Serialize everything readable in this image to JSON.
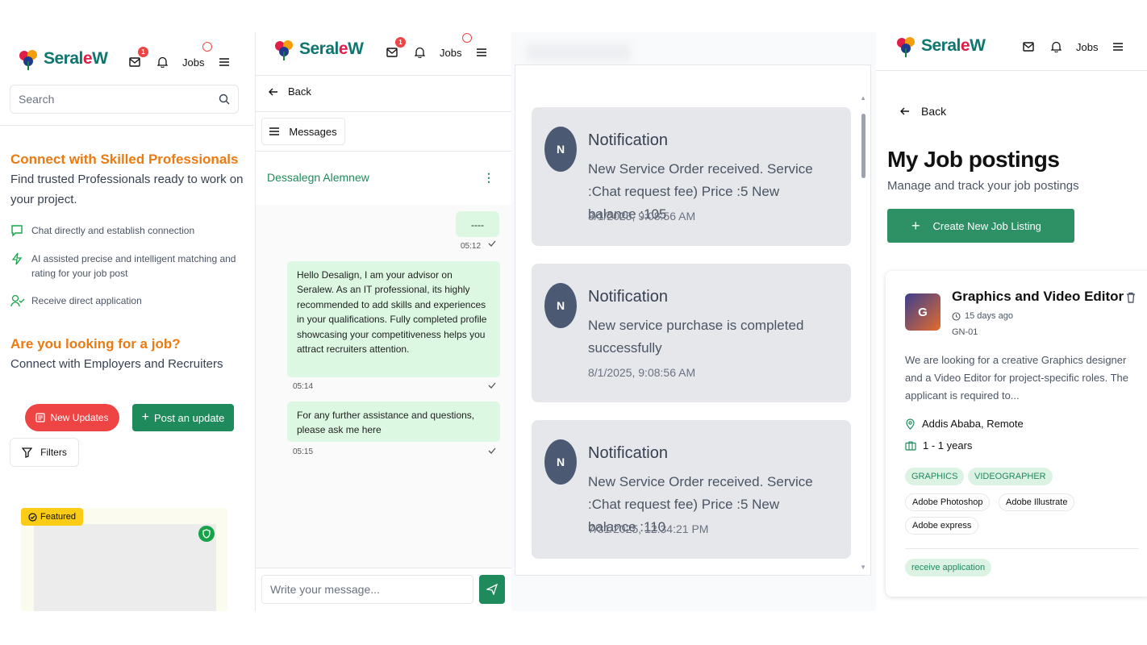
{
  "brand": {
    "logo_text_a": "Seral",
    "logo_text_e": "e",
    "logo_text_w": "W"
  },
  "header": {
    "messages_badge": "1",
    "jobs_label": "Jobs"
  },
  "panel1": {
    "search_placeholder": "Search",
    "headline": "Connect with Skilled Professionals",
    "subheadline": "Find trusted Professionals ready to work on your project.",
    "features": [
      {
        "icon": "chat-icon",
        "text": "Chat directly and establish connection"
      },
      {
        "icon": "lightning-icon",
        "text": "AI assisted precise and intelligent matching and rating for your job post"
      },
      {
        "icon": "user-check-icon",
        "text": "Receive direct application"
      }
    ],
    "job_headline": "Are you looking for a job?",
    "job_sub": "Connect with Employers and Recruiters",
    "new_updates_label": "New Updates",
    "post_update_label": "Post an update",
    "filters_label": "Filters",
    "featured_label": "Featured"
  },
  "panel2": {
    "back_label": "Back",
    "messages_label": "Messages",
    "contact_name": "Dessalegn Alemnew",
    "chat": [
      {
        "text": "----",
        "time": "05:12"
      },
      {
        "text": "Hello Desalign, I am your advisor on Seralew. As an IT professional, its highly recommended to add skills and experiences in your qualifications. Fully completed profile showcasing your competitiveness helps you attract recruiters attention.",
        "time": "05:14"
      },
      {
        "text": "For any further assistance and questions, please ask me here",
        "time": "05:15"
      }
    ],
    "input_placeholder": "Write your message..."
  },
  "panel3": {
    "notifications": [
      {
        "avatar": "N",
        "title": "Notification",
        "body": "New Service Order received. Service :Chat request fee) Price :5 New balance :105",
        "time": "8/1/2025, 9:08:56 AM"
      },
      {
        "avatar": "N",
        "title": "Notification",
        "body": "New service purchase is completed successfully",
        "time": "8/1/2025, 9:08:56 AM"
      },
      {
        "avatar": "N",
        "title": "Notification",
        "body": "New Service Order received. Service :Chat request fee) Price :5 New balance :110",
        "time": "7/31/2025, 12:34:21 PM"
      }
    ]
  },
  "panel4": {
    "back_label": "Back",
    "title": "My Job postings",
    "subtitle": "Manage and track your job postings",
    "create_label": "Create New Job Listing",
    "job": {
      "avatar": "G",
      "title": "Graphics and Video Editor",
      "age": "15 days ago",
      "code": "GN-01",
      "description": "We are looking for a creative Graphics designer and a Video Editor for project-specific roles. The applicant is required to...",
      "location": "Addis Ababa, Remote",
      "experience": "1 - 1 years",
      "categories": [
        "GRAPHICS",
        "VIDEOGRAPHER"
      ],
      "skills": [
        "Adobe Photoshop",
        "Adobe Illustrate",
        "Adobe express"
      ],
      "status": "receive application"
    }
  },
  "colors": {
    "brand_green": "#1f8a5b",
    "accent_orange": "#ea7a12",
    "alert_red": "#ef4444"
  }
}
